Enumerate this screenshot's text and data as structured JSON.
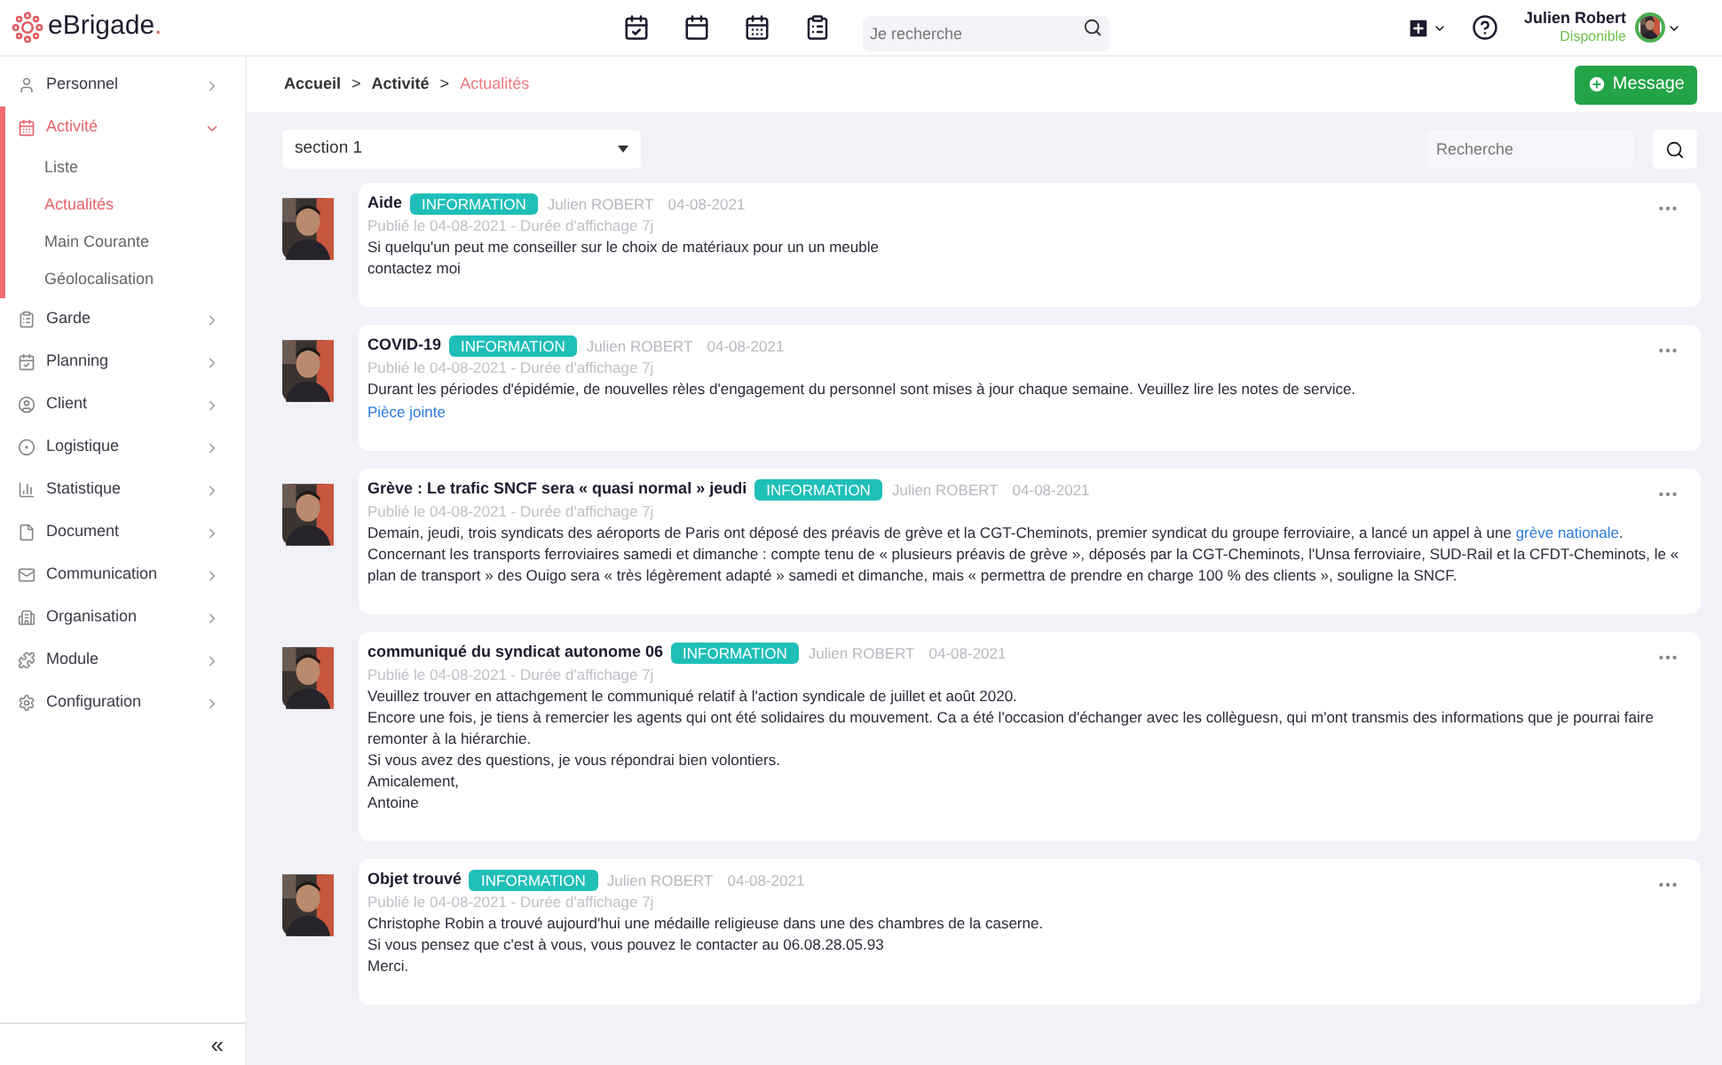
{
  "header": {
    "logo": "eBrigade",
    "logo_dot": ".",
    "search": {
      "placeholder": "Je recherche"
    },
    "user": {
      "name": "Julien Robert",
      "status": "Disponible"
    }
  },
  "sidebar": {
    "items": [
      {
        "kind": "person",
        "label": "Personnel",
        "expanded": false,
        "selected": false
      },
      {
        "kind": "calendar",
        "label": "Activité",
        "expanded": true,
        "selected": true,
        "children": [
          {
            "label": "Liste",
            "selected": false
          },
          {
            "label": "Actualités",
            "selected": true
          },
          {
            "label": "Main Courante",
            "selected": false
          },
          {
            "label": "Géolocalisation",
            "selected": false
          }
        ]
      },
      {
        "kind": "clipboard",
        "label": "Garde",
        "expanded": false,
        "selected": false
      },
      {
        "kind": "planning",
        "label": "Planning",
        "expanded": false,
        "selected": false
      },
      {
        "kind": "client",
        "label": "Client",
        "expanded": false,
        "selected": false
      },
      {
        "kind": "target",
        "label": "Logistique",
        "expanded": false,
        "selected": false
      },
      {
        "kind": "chart",
        "label": "Statistique",
        "expanded": false,
        "selected": false
      },
      {
        "kind": "file",
        "label": "Document",
        "expanded": false,
        "selected": false
      },
      {
        "kind": "mail",
        "label": "Communication",
        "expanded": false,
        "selected": false
      },
      {
        "kind": "building",
        "label": "Organisation",
        "expanded": false,
        "selected": false
      },
      {
        "kind": "puzzle",
        "label": "Module",
        "expanded": false,
        "selected": false
      },
      {
        "kind": "gear",
        "label": "Configuration",
        "expanded": false,
        "selected": false
      }
    ],
    "collapse": "«"
  },
  "breadcrumb": [
    "Accueil",
    "Activité",
    "Actualités"
  ],
  "breadcrumb_separator": ">",
  "message_button": "Message",
  "section_select": "section 1",
  "search": {
    "placeholder": "Recherche"
  },
  "posts": [
    {
      "title": "Aide",
      "badge": "INFORMATION",
      "author": "Julien ROBERT",
      "date": "04-08-2021",
      "published": "Publié le 04-08-2021 - Durée d'affichage 7j",
      "lines": [
        [
          {
            "kind": "text",
            "text": "Si quelqu'un peut me conseiller sur le choix de matériaux pour un un meuble"
          }
        ],
        [
          {
            "kind": "text",
            "text": "contactez moi"
          }
        ]
      ]
    },
    {
      "title": "COVID-19",
      "badge": "INFORMATION",
      "author": "Julien ROBERT",
      "date": "04-08-2021",
      "published": "Publié le 04-08-2021 - Durée d'affichage 7j",
      "lines": [
        [
          {
            "kind": "text",
            "text": "Durant les périodes d'épidémie, de nouvelles rèles d'engagement du personnel sont mises à jour chaque semaine. Veuillez lire les notes de service."
          }
        ],
        [
          {
            "kind": "link",
            "text": "Pièce jointe"
          }
        ]
      ]
    },
    {
      "title": "Grève : Le trafic SNCF sera « quasi normal » jeudi",
      "badge": "INFORMATION",
      "author": "Julien ROBERT",
      "date": "04-08-2021",
      "published": "Publié le 04-08-2021 - Durée d'affichage 7j",
      "lines": [
        [
          {
            "kind": "text",
            "text": "Demain, jeudi, trois syndicats des aéroports de Paris ont déposé des préavis de grève et la CGT-Cheminots, premier syndicat du groupe ferroviaire, a lancé un appel à une "
          },
          {
            "kind": "link",
            "text": "grève nationale"
          },
          {
            "kind": "text",
            "text": "."
          }
        ],
        [
          {
            "kind": "text",
            "text": "Concernant les transports ferroviaires samedi et dimanche : compte tenu de « plusieurs préavis de grève », déposés par la CGT-Cheminots, l'Unsa ferroviaire, SUD-Rail et la CFDT-Cheminots, le « plan de transport » des Ouigo sera « très légèrement adapté » samedi et dimanche, mais « permettra de prendre en charge 100 % des clients », souligne la SNCF."
          }
        ]
      ]
    },
    {
      "title": "communiqué du syndicat autonome 06",
      "badge": "INFORMATION",
      "author": "Julien ROBERT",
      "date": "04-08-2021",
      "published": "Publié le 04-08-2021 - Durée d'affichage 7j",
      "lines": [
        [
          {
            "kind": "text",
            "text": "Veuillez trouver en attachgement le communiqué relatif à l'action syndicale de juillet et août 2020."
          }
        ],
        [
          {
            "kind": "text",
            "text": "Encore une fois, je tiens à remercier les agents qui ont été solidaires du mouvement. Ca a été l'occasion d'échanger avec les collèguesn, qui m'ont  transmis des informations que je pourrai faire remonter à la hiérarchie."
          }
        ],
        [
          {
            "kind": "text",
            "text": "Si vous avez des questions, je vous répondrai bien volontiers."
          }
        ],
        [
          {
            "kind": "text",
            "text": "Amicalement,"
          }
        ],
        [
          {
            "kind": "text",
            "text": "Antoine"
          }
        ]
      ]
    },
    {
      "title": "Objet trouvé",
      "badge": "INFORMATION",
      "author": "Julien ROBERT",
      "date": "04-08-2021",
      "published": "Publié le 04-08-2021 - Durée d'affichage 7j",
      "lines": [
        [
          {
            "kind": "text",
            "text": "Christophe Robin a trouvé aujourd'hui une médaille religieuse dans une des chambres de la caserne."
          }
        ],
        [
          {
            "kind": "text",
            "text": "Si vous pensez que c'est à vous, vous pouvez le contacter au 06.08.28.05.93"
          }
        ],
        [
          {
            "kind": "text",
            "text": "Merci."
          }
        ]
      ]
    }
  ]
}
